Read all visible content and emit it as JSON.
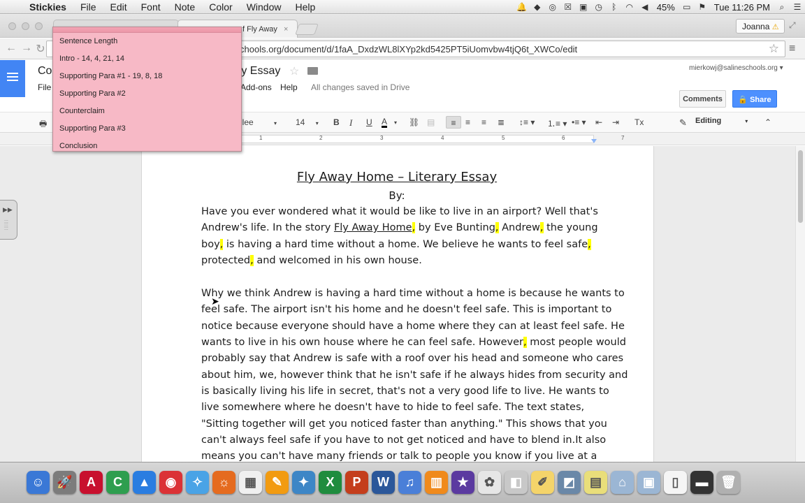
{
  "menubar": {
    "app_name": "Stickies",
    "items": [
      "File",
      "Edit",
      "Font",
      "Note",
      "Color",
      "Window",
      "Help"
    ],
    "battery": "45%",
    "clock": "Tue 11:26 PM"
  },
  "browser": {
    "tab_title": "f Fly Away",
    "tab_close": "×",
    "user": "Joanna",
    "url": "chools.org/document/d/1faA_DxdzWL8lXYp2kd5425PT5iUomvbw4tjQ6t_XWCo/edit"
  },
  "docs": {
    "title_left": "Co",
    "title": "ry Essay",
    "menu_file": "File",
    "menus": [
      "Add-ons",
      "Help"
    ],
    "save_status": "All changes saved in Drive",
    "account": "mierkowj@salineschools.org",
    "comments_label": "Comments",
    "share_label": "Share"
  },
  "format_toolbar": {
    "font_name": "llee",
    "font_size": "14",
    "bold": "B",
    "italic": "I",
    "underline": "U",
    "text_color": "A",
    "mode": "Editing"
  },
  "ruler": [
    "1",
    "2",
    "3",
    "4",
    "5",
    "6",
    "7"
  ],
  "sticky": {
    "items": [
      "Sentence Length",
      "Intro - 14, 4, 21, 14",
      "Supporting Para #1 - 19, 8, 18",
      "Supporting Para #2",
      "Counterclaim",
      "Supporting Para #3",
      "Conclusion"
    ]
  },
  "document": {
    "heading": "Fly Away Home – Literary Essay",
    "byline": "By:",
    "p1": {
      "l1": "Have you ever wondered what it would be like to live in an airport? Well that's",
      "l2a": "Andrew's life. In the story ",
      "l2_title": "Fly Away Home",
      "l2b": " by Eve Bunting",
      "l2c": " Andrew",
      "l2d": " the young",
      "l3a": "boy",
      "l3b": " is having a hard time without a home. We believe he wants to feel safe",
      "l4a": "protected",
      "l4b": " and welcomed in his own house.",
      "comma": ","
    },
    "p2": [
      "Why we think Andrew is having a hard time without a home is because he wants to",
      "feel safe. The airport isn't his home and he doesn't feel safe. This is important to",
      "notice because everyone should have a home where they can at least feel safe. He",
      "wants to live in his own house where he can feel safe. However",
      " most people would",
      "probably say that Andrew is safe with a roof over his head and someone who cares",
      "about him, we, however think that he isn't safe if he always hides from security and",
      "is basically living his life in secret, that's not a very good life to live. He wants to",
      "live somewhere where he doesn't have to hide to feel safe. The text states,",
      "\"Sitting together will get you noticed faster than anything.\" This shows that you",
      "can't always feel safe if you have to not get noticed and have to blend in.It also",
      "means you can't have many friends or talk to people you know if you live at an"
    ]
  },
  "dock": {
    "apps": [
      "Finder",
      "Launchpad",
      "Acrobat",
      "Camtasia",
      "Drive",
      "Chrome",
      "Safari",
      "Firefox",
      "Apps",
      "Pages",
      "Keynote",
      "Excel",
      "PowerPoint",
      "Word",
      "iTunes",
      "iBooks",
      "iMovie",
      "Photos",
      "Preview",
      "Notes",
      "iPhoto",
      "Stickies",
      "Applications",
      "Documents",
      "File",
      "Terminal",
      "Trash"
    ],
    "glyphs": [
      "☺",
      "🚀",
      "A",
      "C",
      "▲",
      "◉",
      "✧",
      "☼",
      "▦",
      "✎",
      "✦",
      "X",
      "P",
      "W",
      "♫",
      "▥",
      "★",
      "✿",
      "◧",
      "✐",
      "◩",
      "▤",
      "⌂",
      "▣",
      "▯",
      "▬",
      "🗑"
    ],
    "colors": [
      "#3a78d6",
      "#7c7c7c",
      "#c8102e",
      "#2e9e4f",
      "#2a7de1",
      "#db3236",
      "#4aa3e6",
      "#e56b1f",
      "#f0f0f0",
      "#f29b11",
      "#3d86c6",
      "#1f8c3e",
      "#c43e1c",
      "#2b579a",
      "#4a7fd8",
      "#f08a1c",
      "#5b3aa0",
      "#e6e6e6",
      "#c8c8c8",
      "#f4d46a",
      "#6a88a8",
      "#e9de7a",
      "#9bb6d4",
      "#9bb6d4",
      "#f5f5f5",
      "#333333",
      "#b0b0b0"
    ]
  }
}
